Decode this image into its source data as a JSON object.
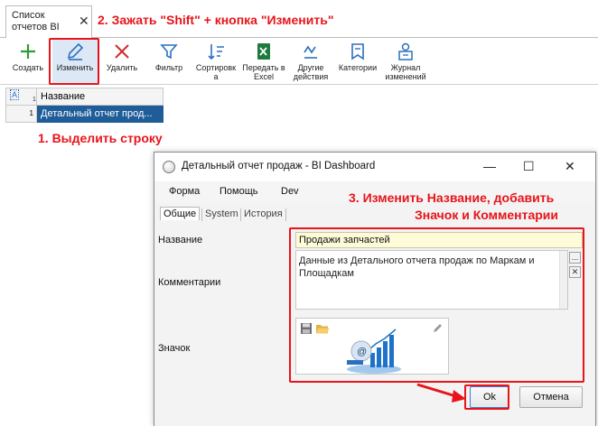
{
  "tab": {
    "title": "Список отчетов BI",
    "close_glyph": "✕"
  },
  "toolbar": {
    "buttons": [
      {
        "label": "Создать",
        "icon": "plus-icon"
      },
      {
        "label": "Изменить",
        "icon": "pencil-icon"
      },
      {
        "label": "Удалить",
        "icon": "delete-x-icon"
      },
      {
        "label": "Фильтр",
        "icon": "filter-icon"
      },
      {
        "label": "Сортировк а",
        "icon": "sort-icon"
      },
      {
        "label": "Передать в Excel",
        "icon": "excel-icon"
      },
      {
        "label": "Другие действия",
        "icon": "actions-icon"
      },
      {
        "label": "Категории",
        "icon": "bookmark-icon"
      },
      {
        "label": "Журнал изменений",
        "icon": "log-user-icon"
      }
    ]
  },
  "grid": {
    "corner_label": "A",
    "column_header": "Название",
    "rows": [
      {
        "num": "1",
        "name": "Детальный отчет прод..."
      }
    ]
  },
  "annotations": {
    "step2": "2. Зажать \"Shift\" + кнопка \"Изменить\"",
    "step1": "1. Выделить строку",
    "step3_line1": "3. Изменить Название, добавить",
    "step3_line2": "Значок и Комментарии"
  },
  "dialog": {
    "title": "Детальный отчет продаж - BI Dashboard",
    "controls": {
      "minimize": "—",
      "maximize": "☐",
      "close": "✕"
    },
    "menu": [
      "Форма",
      "Помощь",
      "Dev"
    ],
    "subtabs": [
      "Общие",
      "System",
      "История"
    ],
    "labels": {
      "name": "Название",
      "comments": "Комментарии",
      "icon": "Значок"
    },
    "name_value": "Продажи запчастей",
    "comment_value": "Данные из Детального отчета продаж по Маркам и Площадкам",
    "side_buttons": {
      "more": "...",
      "clear": "✕"
    },
    "buttons": {
      "ok": "Ok",
      "cancel": "Отмена"
    }
  },
  "colors": {
    "annotation_red": "#e8141a",
    "selection_blue": "#1f5d99",
    "name_field_bg": "#fdfbd8"
  }
}
